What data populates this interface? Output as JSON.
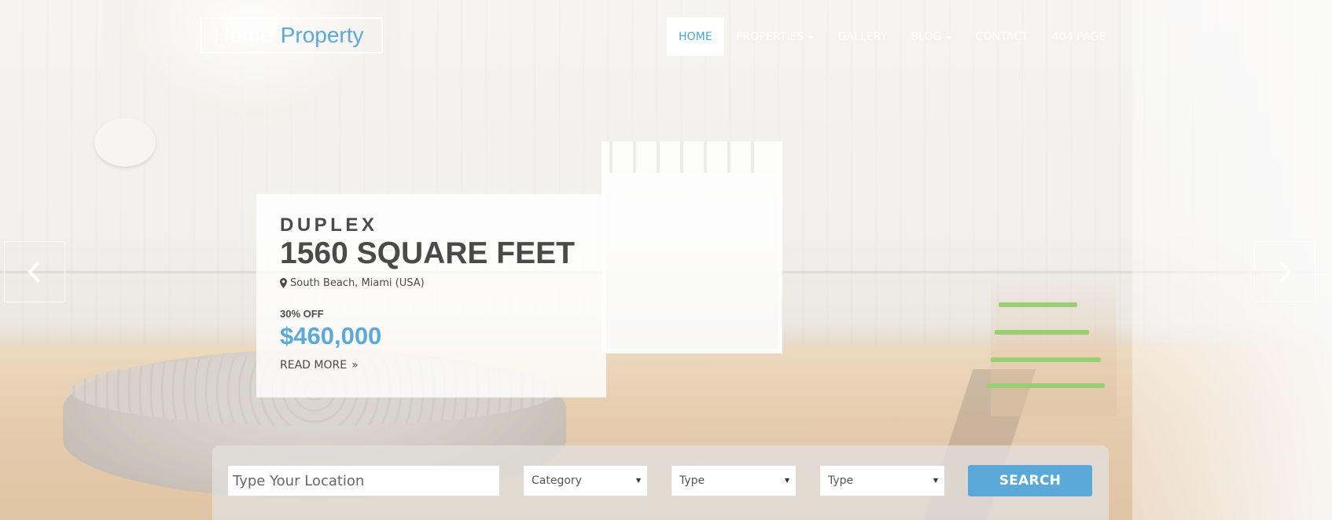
{
  "brand": {
    "logo_word1": "Home",
    "logo_word2": "Property",
    "accent_color": "#5aa9d9"
  },
  "nav": {
    "items": [
      {
        "label": "HOME",
        "active": true
      },
      {
        "label": "PROPERTIES",
        "dropdown": true
      },
      {
        "label": "GALLERY"
      },
      {
        "label": "BLOG",
        "dropdown": true
      },
      {
        "label": "CONTACT"
      },
      {
        "label": "404 PAGE"
      }
    ]
  },
  "slider": {
    "prev_icon": "chevron-left-icon",
    "next_icon": "chevron-right-icon"
  },
  "listing": {
    "kicker": "DUPLEX",
    "headline": "1560 SQUARE FEET",
    "location": "South Beach, Miami (USA)",
    "discount": "30% OFF",
    "price": "$460,000",
    "read_more": "READ MORE"
  },
  "search": {
    "location_placeholder": "Type Your Location",
    "category": "Category",
    "type1": "Type",
    "type2": "Type",
    "button": "SEARCH"
  }
}
